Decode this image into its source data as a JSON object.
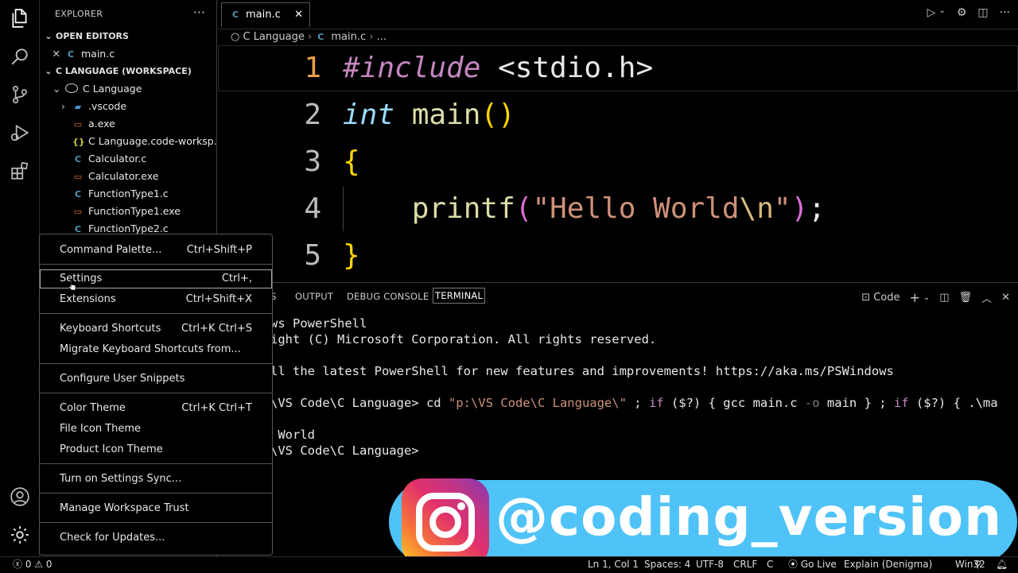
{
  "sidebar": {
    "title": "EXPLORER",
    "more": "···",
    "open_editors_label": "OPEN EDITORS",
    "open_editor_file": "main.c",
    "workspace_label": "C LANGUAGE (WORKSPACE)",
    "folder": "C Language",
    "files": [
      ".vscode",
      "a.exe",
      "C Language.code-worksp...",
      "Calculator.c",
      "Calculator.exe",
      "FunctionType1.c",
      "FunctionType1.exe",
      "FunctionType2.c"
    ]
  },
  "tab": {
    "icon": "C",
    "label": "main.c",
    "close": "✕"
  },
  "breadcrumb": {
    "folder": "C Language",
    "file": "main.c",
    "more": "..."
  },
  "editor": {
    "lines": [
      "1",
      "2",
      "3",
      "4",
      "5"
    ],
    "l1_kw": "#include",
    "l1_rest": " <stdio.h>",
    "l2_kw": "int",
    "l2_fn": " main",
    "l2_paren": "()",
    "l3": "{",
    "l4_fn": "printf",
    "l4_open": "(",
    "l4_str1": "\"Hello World",
    "l4_esc": "\\n",
    "l4_str2": "\"",
    "l4_close": ")",
    "l4_semi": ";",
    "l5": "}"
  },
  "panel": {
    "tabs": [
      "S",
      "OUTPUT",
      "DEBUG CONSOLE",
      "TERMINAL"
    ],
    "terminal_name": "Code",
    "add": "+",
    "terminal_lines": {
      "l1": "ws PowerShell",
      "l2": "ight (C) Microsoft Corporation. All rights reserved.",
      "l3": "ll the latest PowerShell for new features and improvements! https://aka.ms/PSWindows",
      "l4_prompt": "\\VS Code\\C Language> cd ",
      "l4_path": "\"p:\\VS Code\\C Language\\\"",
      "l4_a": " ; ",
      "l4_if1": "if",
      "l4_b": " ($?) { gcc main.c ",
      "l4_opt": "-o",
      "l4_c": " main } ; ",
      "l4_if2": "if",
      "l4_d": " ($?) { .\\ma",
      "l5": " World",
      "l6": "\\VS Code\\C Language>"
    }
  },
  "menu": {
    "items": [
      {
        "label": "Command Palette...",
        "kb": "Ctrl+Shift+P"
      },
      {
        "label": "Settings",
        "kb": "Ctrl+,"
      },
      {
        "label": "Extensions",
        "kb": "Ctrl+Shift+X"
      },
      {
        "label": "Keyboard Shortcuts",
        "kb": "Ctrl+K Ctrl+S"
      },
      {
        "label": "Migrate Keyboard Shortcuts from...",
        "kb": ""
      },
      {
        "label": "Configure User Snippets",
        "kb": ""
      },
      {
        "label": "Color Theme",
        "kb": "Ctrl+K Ctrl+T"
      },
      {
        "label": "File Icon Theme",
        "kb": ""
      },
      {
        "label": "Product Icon Theme",
        "kb": ""
      },
      {
        "label": "Turn on Settings Sync...",
        "kb": ""
      },
      {
        "label": "Manage Workspace Trust",
        "kb": ""
      },
      {
        "label": "Check for Updates...",
        "kb": ""
      }
    ]
  },
  "overlay": {
    "handle": "@coding_version"
  },
  "status": {
    "errors": "0",
    "warnings": "0",
    "position": "Ln 1, Col 1",
    "spaces": "Spaces: 4",
    "encoding": "UTF-8",
    "eol": "CRLF",
    "language": "C",
    "golive": "Go Live",
    "explain": "Explain (Denigma)",
    "platform": "Win32"
  }
}
